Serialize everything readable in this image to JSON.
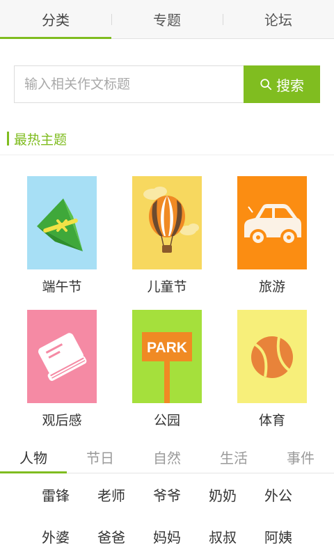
{
  "top_tabs": [
    {
      "label": "分类",
      "active": true
    },
    {
      "label": "专题",
      "active": false
    },
    {
      "label": "论坛",
      "active": false
    }
  ],
  "search": {
    "placeholder": "输入相关作文标题",
    "button_label": "搜索"
  },
  "section": {
    "title": "最热主题"
  },
  "topics": [
    {
      "label": "端午节",
      "icon": "zongzi-icon",
      "color": "#a7dff5"
    },
    {
      "label": "儿童节",
      "icon": "hot-air-balloon-icon",
      "color": "#f7d85f"
    },
    {
      "label": "旅游",
      "icon": "car-icon",
      "color": "#fb8d12"
    },
    {
      "label": "观后感",
      "icon": "book-icon",
      "color": "#f58aa4"
    },
    {
      "label": "公园",
      "icon": "park-sign-icon",
      "color": "#a5e03c",
      "sign_text": "PARK"
    },
    {
      "label": "体育",
      "icon": "ball-icon",
      "color": "#f7ef7a"
    }
  ],
  "category_tabs": [
    {
      "label": "人物",
      "active": true
    },
    {
      "label": "节日",
      "active": false
    },
    {
      "label": "自然",
      "active": false
    },
    {
      "label": "生活",
      "active": false
    },
    {
      "label": "事件",
      "active": false
    }
  ],
  "tags": [
    [
      "雷锋",
      "老师",
      "爷爷",
      "奶奶",
      "外公"
    ],
    [
      "外婆",
      "爸爸",
      "妈妈",
      "叔叔",
      "阿姨"
    ]
  ],
  "colors": {
    "accent": "#7fbc1f"
  }
}
